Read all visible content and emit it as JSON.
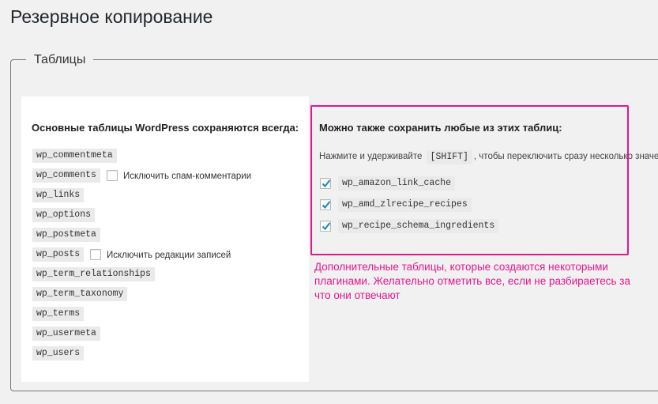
{
  "page": {
    "title": "Резервное копирование"
  },
  "fieldset": {
    "legend": "Таблицы"
  },
  "core_tables": {
    "heading": "Основные таблицы WordPress сохраняются всегда:",
    "tables": [
      "wp_commentmeta",
      "wp_comments",
      "wp_links",
      "wp_options",
      "wp_postmeta",
      "wp_posts",
      "wp_term_relationships",
      "wp_term_taxonomy",
      "wp_terms",
      "wp_usermeta",
      "wp_users"
    ],
    "exclude_spam_label": "Исключить спам-комментарии",
    "exclude_revisions_label": "Исключить редакции записей"
  },
  "extra_tables": {
    "heading": "Можно также сохранить любые из этих таблиц:",
    "hint_before": "Нажмите и удерживайте",
    "hint_key": "[SHIFT]",
    "hint_after": ", чтобы переключить сразу несколько значе",
    "tables": [
      {
        "name": "wp_amazon_link_cache",
        "checked": true
      },
      {
        "name": "wp_amd_zlrecipe_recipes",
        "checked": true
      },
      {
        "name": "wp_recipe_schema_ingredients",
        "checked": true
      }
    ]
  },
  "annotation": {
    "text": "Дополнительные таблицы, которые создаются некоторыми плагинами. Желательно отметить все, если не разбираетесь за что они отвечают",
    "color": "#e5178b"
  },
  "colors": {
    "accent": "#e5178b",
    "check": "#1e8cbe"
  }
}
